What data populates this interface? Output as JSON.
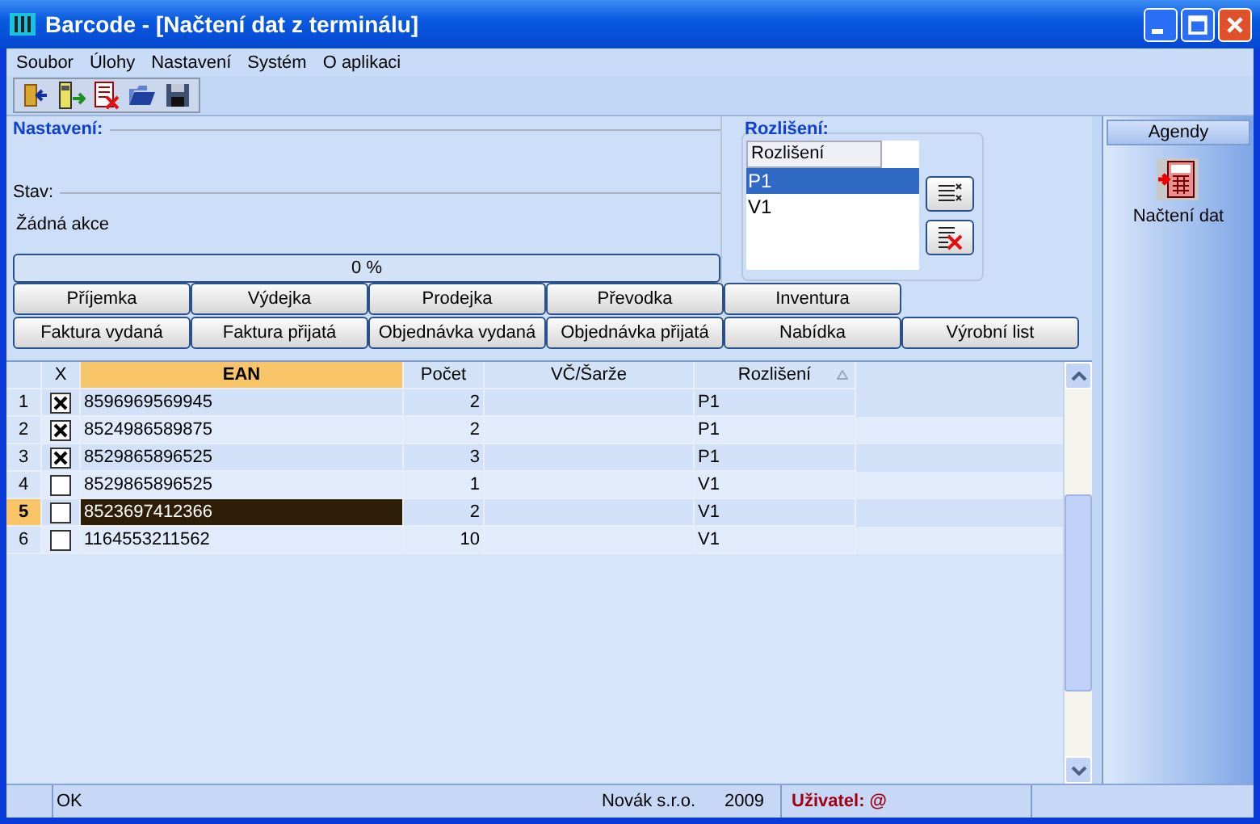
{
  "window": {
    "title": "Barcode - [Načtení dat z terminálu]"
  },
  "menu": [
    "Soubor",
    "Úlohy",
    "Nastavení",
    "Systém",
    "O aplikaci"
  ],
  "settings": {
    "title": "Nastavení:",
    "state_label": "Stav:",
    "state": "Žádná akce",
    "progress": {
      "level": 0,
      "reading": "0 %"
    }
  },
  "resolution": {
    "title": "Rozlišení:",
    "column": "Rozlišení",
    "items": [
      {
        "label": "P1",
        "selected": true
      },
      {
        "label": "V1",
        "selected": false
      }
    ]
  },
  "buttons": [
    [
      "Příjemka",
      "Výdejka",
      "Prodejka",
      "Převodka",
      "Inventura"
    ],
    [
      "Faktura vydaná",
      "Faktura přijatá",
      "Objednávka vydaná",
      "Objednávka přijatá",
      "Nabídka",
      "Výrobní list"
    ]
  ],
  "table": {
    "columns": [
      "X",
      "EAN",
      "Počet",
      "VČ/Šarže",
      "Rozlišení"
    ],
    "rows": [
      {
        "number": "1",
        "checked": true,
        "ean": "8596969569945",
        "count": "2",
        "resolution": "P1",
        "selected": false
      },
      {
        "number": "2",
        "checked": true,
        "ean": "8524986589875",
        "count": "2",
        "resolution": "P1",
        "selected": false
      },
      {
        "number": "3",
        "checked": true,
        "ean": "8529865896525",
        "count": "3",
        "resolution": "P1",
        "selected": false
      },
      {
        "number": "4",
        "checked": false,
        "ean": "8529865896525",
        "count": "1",
        "resolution": "V1",
        "selected": false
      },
      {
        "number": "5",
        "checked": false,
        "ean": "8523697412366",
        "count": "2",
        "resolution": "V1",
        "selected": true
      },
      {
        "number": "6",
        "checked": false,
        "ean": "1164553211562",
        "count": "10",
        "resolution": "V1",
        "selected": false
      }
    ]
  },
  "agendas": {
    "title": "Agendy",
    "items": [
      {
        "label": "Načtení dat"
      }
    ]
  },
  "status_bar": {
    "message": "OK",
    "company": "Novák s.r.o.",
    "year": "2009",
    "user": "Uživatel: @"
  }
}
